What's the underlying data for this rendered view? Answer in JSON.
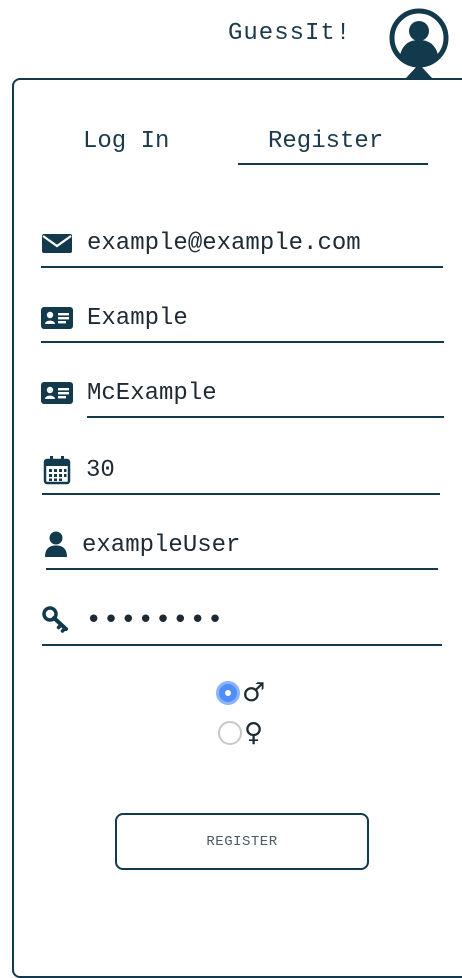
{
  "header": {
    "brand": "GuessIt!",
    "avatar_icon": "user-circle-icon"
  },
  "tabs": [
    {
      "label": "Log In",
      "active": false
    },
    {
      "label": "Register",
      "active": true
    }
  ],
  "form": {
    "email": {
      "icon": "envelope-icon",
      "value": "example@example.com"
    },
    "first_name": {
      "icon": "id-card-icon",
      "value": "Example"
    },
    "last_name": {
      "icon": "id-card-icon",
      "value": "McExample"
    },
    "age": {
      "icon": "calendar-icon",
      "value": "30"
    },
    "username": {
      "icon": "user-icon",
      "value": "exampleUser"
    },
    "password": {
      "icon": "key-icon",
      "value": "••••••••"
    },
    "gender": {
      "options": [
        {
          "symbol": "♂",
          "selected": true
        },
        {
          "symbol": "♀",
          "selected": false
        }
      ]
    },
    "submit_label": "REGISTER"
  },
  "colors": {
    "primary": "#123a4c",
    "radio_selected": "#4f8ef7"
  }
}
